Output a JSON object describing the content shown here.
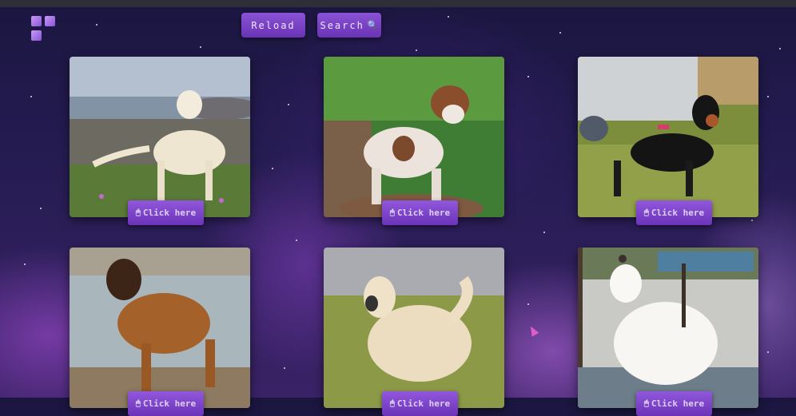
{
  "toolbar": {
    "reload_label": "Reload",
    "search_label": "Search",
    "search_icon": "🔍"
  },
  "cards": [
    {
      "button_label": "Click here",
      "button_icon": "🖱",
      "subject": "yellow labrador on rocky coast"
    },
    {
      "button_label": "Click here",
      "button_icon": "🖱",
      "subject": "brown-white curly water dog"
    },
    {
      "button_label": "Click here",
      "button_icon": "🖱",
      "subject": "black and tan pinscher on grass"
    },
    {
      "button_label": "Click here",
      "button_icon": "🖱",
      "subject": "leonberger by a lake"
    },
    {
      "button_label": "Click here",
      "button_icon": "🖱",
      "subject": "long-haired lhasa apso in field"
    },
    {
      "button_label": "Click here",
      "button_icon": "🖱",
      "subject": "white maltese on porch"
    }
  ],
  "colors": {
    "button": "#7b43c8",
    "background": "#251c52"
  }
}
